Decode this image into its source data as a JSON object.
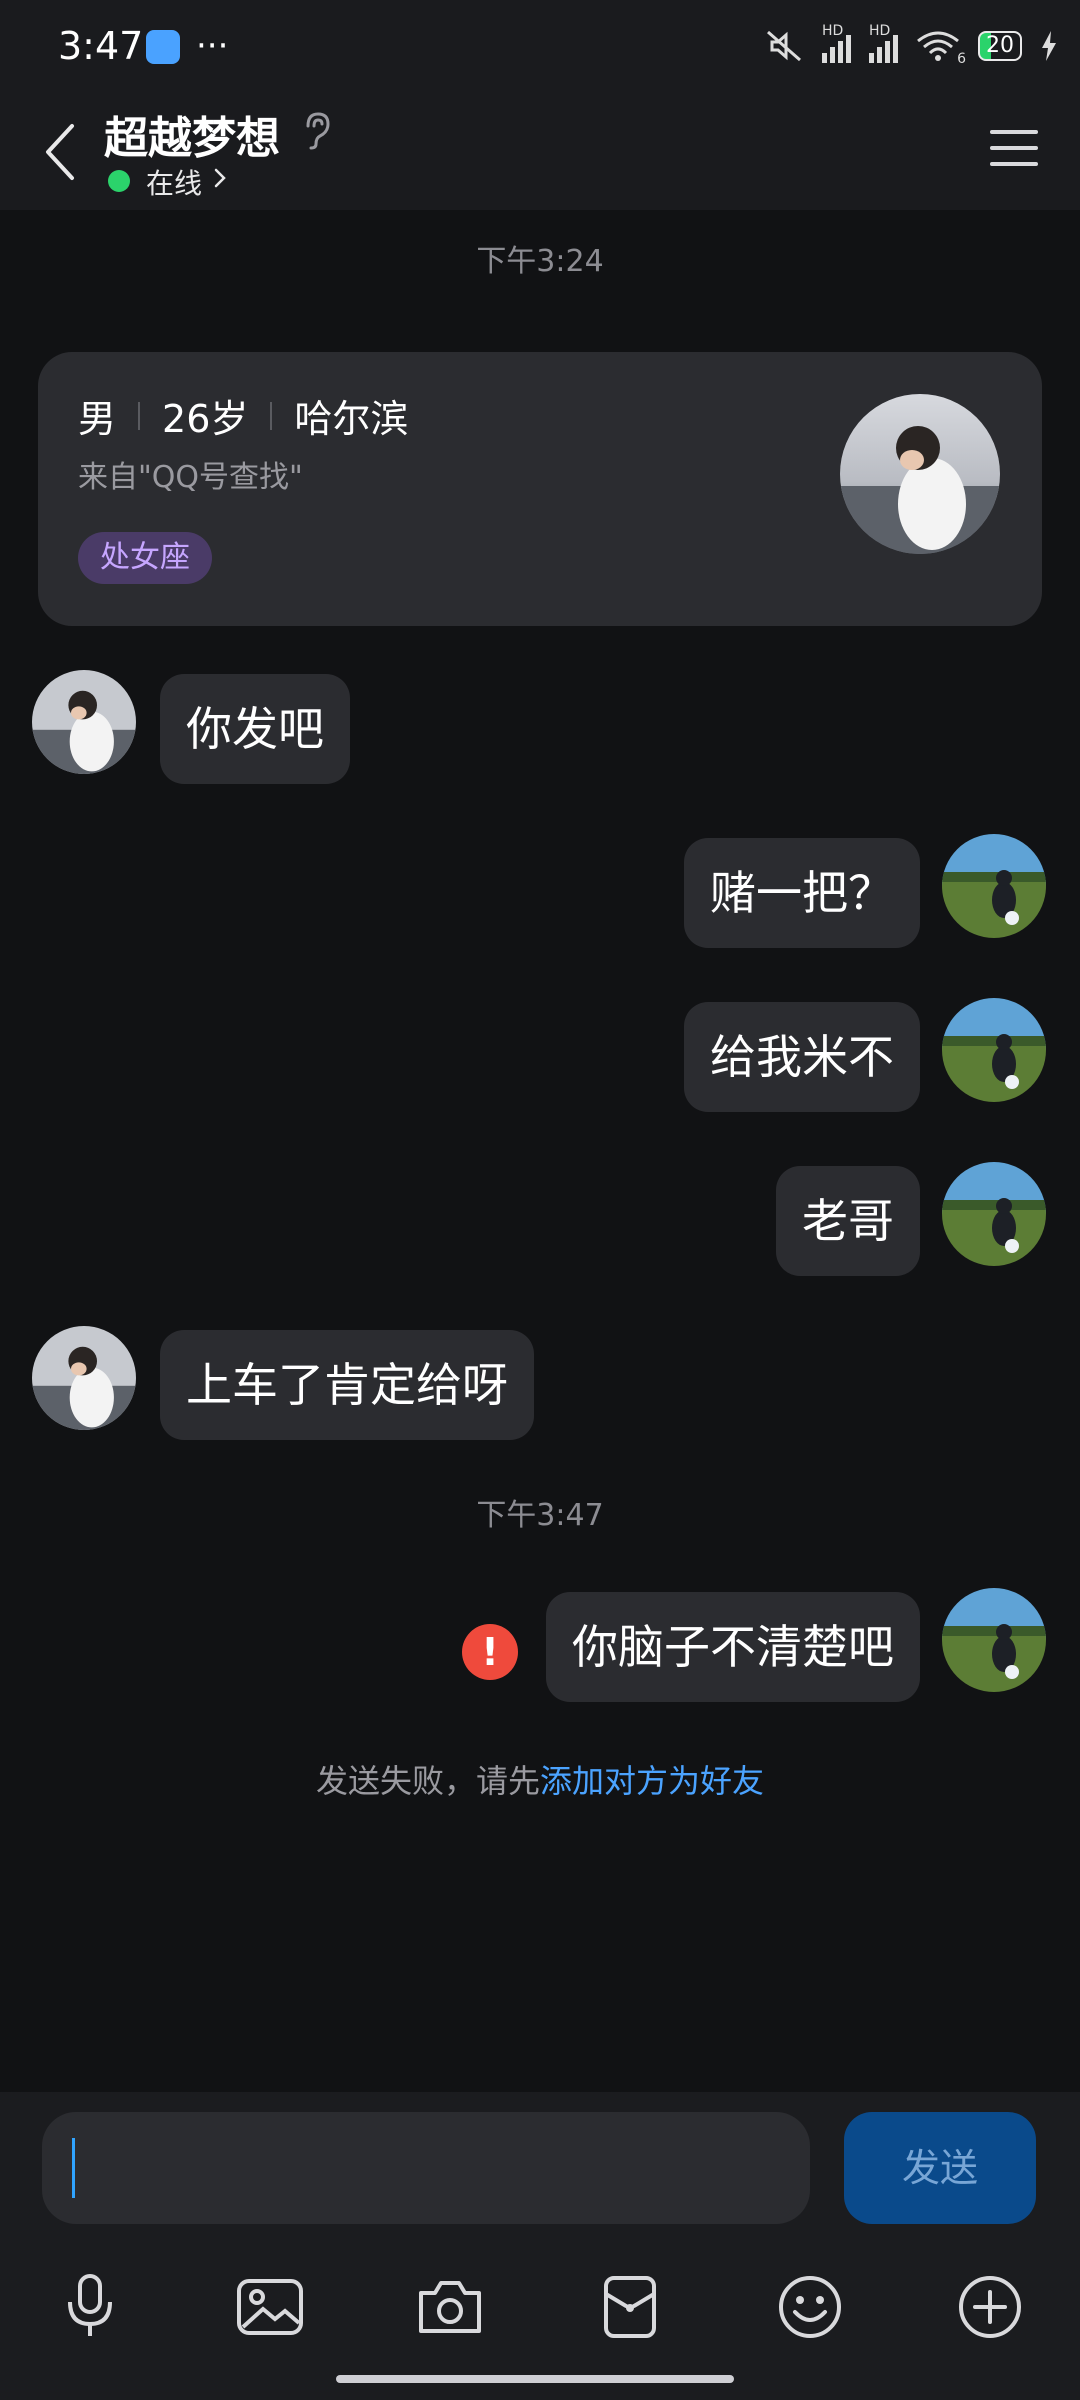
{
  "status_bar": {
    "time": "3:47",
    "more": "···",
    "hd1": "HD",
    "hd2": "HD",
    "wifi_badge": "6",
    "battery": "20"
  },
  "header": {
    "title": "超越梦想",
    "status": "在线"
  },
  "timestamps": [
    "下午3:24",
    "下午3:47"
  ],
  "profile_card": {
    "gender": "男",
    "age": "26岁",
    "city": "哈尔滨",
    "source": "来自\"QQ号查找\"",
    "tag": "处女座"
  },
  "messages": [
    {
      "side": "left",
      "text": "你发吧"
    },
    {
      "side": "right",
      "text": "赌一把？"
    },
    {
      "side": "right",
      "text": "给我米不"
    },
    {
      "side": "right",
      "text": "老哥"
    },
    {
      "side": "left",
      "text": "上车了肯定给呀"
    },
    {
      "side": "right",
      "text": "你脑子不清楚吧",
      "failed": true
    }
  ],
  "failure_notice": {
    "text": "发送失败，请先",
    "link": "添加对方为好友"
  },
  "composer": {
    "send_label": "发送",
    "placeholder": ""
  },
  "toolbar_icons": [
    "microphone-icon",
    "image-icon",
    "camera-icon",
    "wallet-icon",
    "emoji-icon",
    "plus-icon"
  ],
  "colors": {
    "background": "#111214",
    "bubble": "#2b2c30",
    "online": "#2bd36b",
    "link": "#4ba3ff",
    "send_button": "#0a4a8b",
    "error": "#ef4a3c",
    "tag_bg": "#4a3b67",
    "tag_text": "#c6a6ff"
  }
}
